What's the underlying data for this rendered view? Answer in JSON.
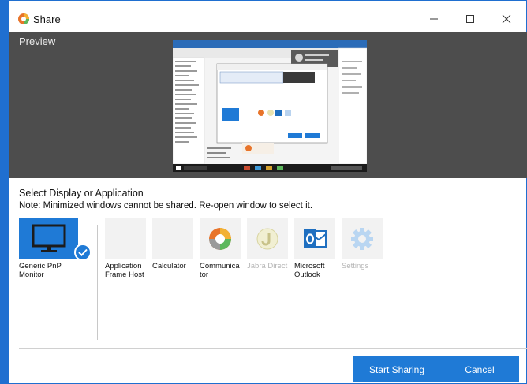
{
  "window": {
    "title": "Share"
  },
  "preview": {
    "label": "Preview"
  },
  "select": {
    "title": "Select Display or Application",
    "note": "Note: Minimized windows cannot be shared. Re-open window to select it."
  },
  "sources": [
    {
      "label": "Generic PnP Monitor",
      "icon": "monitor-icon",
      "selected": true,
      "disabled": false
    },
    {
      "label": "Application Frame Host",
      "icon": "blank-app-icon",
      "selected": false,
      "disabled": false
    },
    {
      "label": "Calculator",
      "icon": "blank-app-icon",
      "selected": false,
      "disabled": false
    },
    {
      "label": "Communica tor",
      "icon": "communicator-icon",
      "selected": false,
      "disabled": false
    },
    {
      "label": "Jabra Direct",
      "icon": "jabra-icon",
      "selected": false,
      "disabled": true
    },
    {
      "label": "Microsoft Outlook",
      "icon": "outlook-icon",
      "selected": false,
      "disabled": false
    },
    {
      "label": "Settings",
      "icon": "gear-icon",
      "selected": false,
      "disabled": true
    }
  ],
  "buttons": {
    "start": "Start Sharing",
    "cancel": "Cancel"
  },
  "colors": {
    "accent": "#1f7ad6",
    "preview_bg": "#4d4d4d"
  }
}
